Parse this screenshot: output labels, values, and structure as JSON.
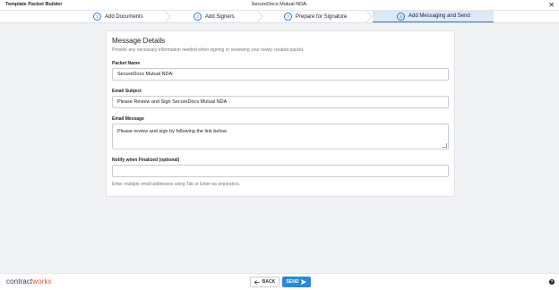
{
  "titlebar": {
    "app_title": "Template Packet Builder",
    "document_title": "SecureDocs Mutual NDA:",
    "close_glyph": "✕"
  },
  "stepper": {
    "steps": [
      {
        "number": "1",
        "label": "Add Documents"
      },
      {
        "number": "2",
        "label": "Add Signers"
      },
      {
        "number": "3",
        "label": "Prepare for Signature"
      },
      {
        "number": "4",
        "label": "Add Messaging and Send",
        "active": true
      }
    ]
  },
  "card": {
    "title": "Message Details",
    "subtitle": "Provide any necessary information needed when signing or reviewing your newly created packet.",
    "packet_name": {
      "label": "Packet Name",
      "value": "SecureDocs Mutual NDA:"
    },
    "email_subject": {
      "label": "Email Subject",
      "value": "Please Review and Sign SecureDocs Mutual NDA"
    },
    "email_message": {
      "label": "Email Message",
      "value": "Please review and sign by following the link below."
    },
    "notify": {
      "label": "Notify when Finalized (optional)",
      "value": "",
      "hint": "Enter multiple email addresses using Tab or Enter as separators."
    }
  },
  "footer": {
    "logo_main": "contract",
    "logo_accent": "works",
    "back_label": "BACK",
    "send_label": "SEND",
    "help_glyph": "?"
  },
  "colors": {
    "accent": "#2b88d8",
    "logo_accent": "#e1552c",
    "active_step_bg": "#dbe9f8"
  }
}
